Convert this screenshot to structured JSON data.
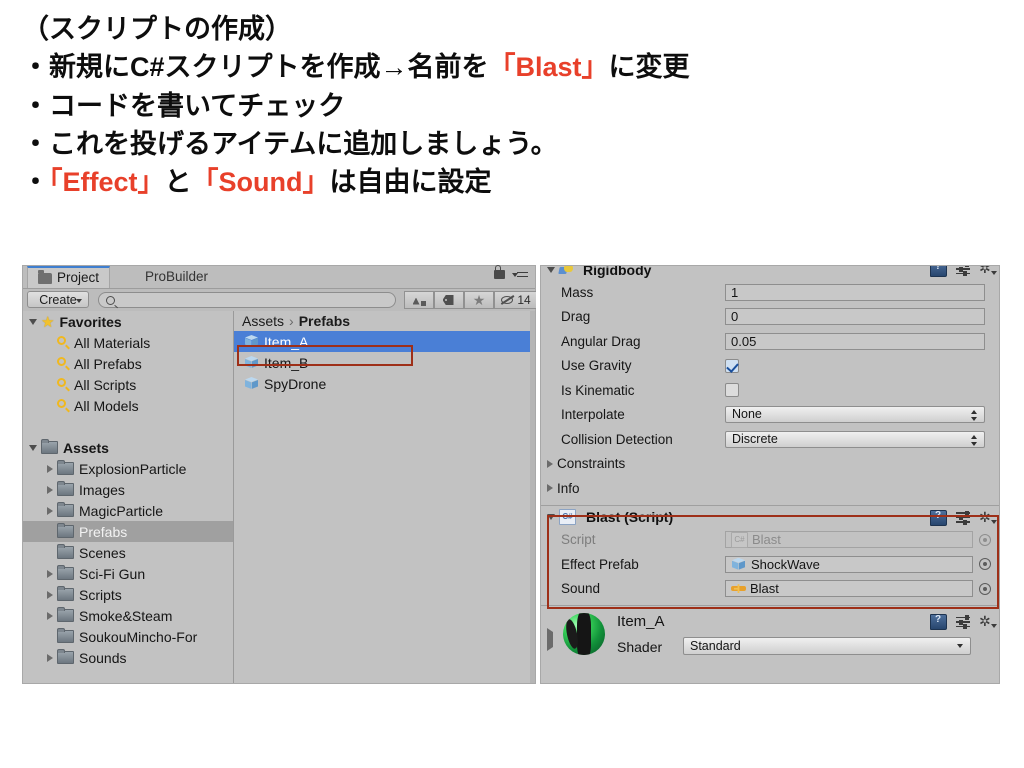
{
  "slide": {
    "lines": [
      {
        "segments": [
          {
            "t": "（スクリプトの作成）",
            "c": "normal"
          }
        ]
      },
      {
        "segments": [
          {
            "t": "・新規にC#スクリプトを作成→名前を",
            "c": "normal"
          },
          {
            "t": "「Blast」",
            "c": "hl"
          },
          {
            "t": "に変更",
            "c": "normal"
          }
        ]
      },
      {
        "segments": [
          {
            "t": "・コードを書いてチェック",
            "c": "normal"
          }
        ]
      },
      {
        "segments": [
          {
            "t": "・これを投げるアイテムに追加しましょう。",
            "c": "normal"
          }
        ]
      },
      {
        "segments": [
          {
            "t": "・",
            "c": "normal"
          },
          {
            "t": "「Effect」",
            "c": "hl"
          },
          {
            "t": "と",
            "c": "normal"
          },
          {
            "t": "「Sound」",
            "c": "hl"
          },
          {
            "t": "は自由に設定",
            "c": "normal"
          }
        ]
      }
    ],
    "accent_color": "#e8402a",
    "text_color": "#0d0d0d"
  },
  "project_panel": {
    "tabs": [
      {
        "label": "Project",
        "active": true
      },
      {
        "label": "ProBuilder",
        "active": false
      }
    ],
    "toolbar": {
      "create_label": "Create",
      "search_value": "",
      "search_placeholder": "",
      "hidden_count": "14"
    },
    "tree": [
      {
        "label": "Favorites",
        "icon": "star",
        "expand": "down",
        "depth": 0,
        "bold": true,
        "selected": false
      },
      {
        "label": "All Materials",
        "icon": "search",
        "expand": "none",
        "depth": 1,
        "bold": false,
        "selected": false
      },
      {
        "label": "All Prefabs",
        "icon": "search",
        "expand": "none",
        "depth": 1,
        "bold": false,
        "selected": false
      },
      {
        "label": "All Scripts",
        "icon": "search",
        "expand": "none",
        "depth": 1,
        "bold": false,
        "selected": false
      },
      {
        "label": "All Models",
        "icon": "search",
        "expand": "none",
        "depth": 1,
        "bold": false,
        "selected": false
      },
      {
        "label": "",
        "icon": "none",
        "expand": "none",
        "depth": 0,
        "bold": false,
        "selected": false
      },
      {
        "label": "Assets",
        "icon": "folder",
        "expand": "down",
        "depth": 0,
        "bold": true,
        "selected": false
      },
      {
        "label": "ExplosionParticle",
        "icon": "folder",
        "expand": "right",
        "depth": 1,
        "bold": false,
        "selected": false
      },
      {
        "label": "Images",
        "icon": "folder",
        "expand": "right",
        "depth": 1,
        "bold": false,
        "selected": false
      },
      {
        "label": "MagicParticle",
        "icon": "folder",
        "expand": "right",
        "depth": 1,
        "bold": false,
        "selected": false
      },
      {
        "label": "Prefabs",
        "icon": "folder",
        "expand": "none",
        "depth": 1,
        "bold": false,
        "selected": true
      },
      {
        "label": "Scenes",
        "icon": "folder",
        "expand": "none",
        "depth": 1,
        "bold": false,
        "selected": false
      },
      {
        "label": "Sci-Fi Gun",
        "icon": "folder",
        "expand": "right",
        "depth": 1,
        "bold": false,
        "selected": false
      },
      {
        "label": "Scripts",
        "icon": "folder",
        "expand": "right",
        "depth": 1,
        "bold": false,
        "selected": false
      },
      {
        "label": "Smoke&Steam",
        "icon": "folder",
        "expand": "right",
        "depth": 1,
        "bold": false,
        "selected": false
      },
      {
        "label": "SoukouMincho-For",
        "icon": "folder",
        "expand": "none",
        "depth": 1,
        "bold": false,
        "selected": false
      },
      {
        "label": "Sounds",
        "icon": "folder",
        "expand": "right",
        "depth": 1,
        "bold": false,
        "selected": false
      }
    ],
    "breadcrumb": {
      "root": "Assets",
      "sep": "›",
      "current": "Prefabs"
    },
    "assets": [
      {
        "label": "Item_A",
        "icon": "prefab-cube",
        "selected": true,
        "highlighted": true
      },
      {
        "label": "Item_B",
        "icon": "prefab-cube",
        "selected": false,
        "highlighted": false
      },
      {
        "label": "SpyDrone",
        "icon": "prefab-cube",
        "selected": false,
        "highlighted": false
      }
    ]
  },
  "inspector": {
    "rigidbody": {
      "title": "Rigidbody",
      "rows": [
        {
          "label": "Mass",
          "type": "field",
          "value": "1"
        },
        {
          "label": "Drag",
          "type": "field",
          "value": "0"
        },
        {
          "label": "Angular Drag",
          "type": "field",
          "value": "0.05"
        },
        {
          "label": "Use Gravity",
          "type": "checkbox",
          "value": "checked"
        },
        {
          "label": "Is Kinematic",
          "type": "checkbox",
          "value": "unchecked"
        },
        {
          "label": "Interpolate",
          "type": "dropdown",
          "value": "None"
        },
        {
          "label": "Collision Detection",
          "type": "dropdown",
          "value": "Discrete"
        }
      ],
      "foldouts": [
        {
          "label": "Constraints"
        },
        {
          "label": "Info"
        }
      ]
    },
    "blast_script": {
      "title": "Blast (Script)",
      "icon": "csharp-script-icon",
      "rows": [
        {
          "label": "Script",
          "value": "Blast",
          "icon": "csharp-script-icon",
          "dim": true
        },
        {
          "label": "Effect Prefab",
          "value": "ShockWave",
          "icon": "prefab-cube",
          "dim": false
        },
        {
          "label": "Sound",
          "value": "Blast",
          "icon": "audio-clip-icon",
          "dim": false
        }
      ],
      "highlight_color": "#9e2f18"
    },
    "material": {
      "name": "Item_A",
      "shader_label": "Shader",
      "shader_value": "Standard"
    }
  }
}
